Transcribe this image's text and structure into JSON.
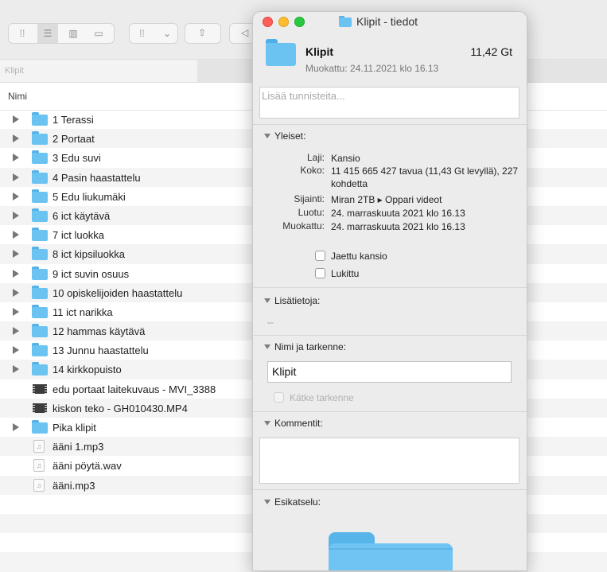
{
  "finder": {
    "path_current": "Klipit",
    "column_name": "Nimi",
    "rows": [
      {
        "label": "1 Terassi",
        "kind": "folder",
        "expandable": true
      },
      {
        "label": "2 Portaat",
        "kind": "folder",
        "expandable": true
      },
      {
        "label": "3 Edu suvi",
        "kind": "folder",
        "expandable": true
      },
      {
        "label": "4 Pasin haastattelu",
        "kind": "folder",
        "expandable": true
      },
      {
        "label": "5 Edu liukumäki",
        "kind": "folder",
        "expandable": true
      },
      {
        "label": "6 ict käytävä",
        "kind": "folder",
        "expandable": true
      },
      {
        "label": "7 ict luokka",
        "kind": "folder",
        "expandable": true
      },
      {
        "label": "8 ict kipsiluokka",
        "kind": "folder",
        "expandable": true
      },
      {
        "label": "9 ict suvin osuus",
        "kind": "folder",
        "expandable": true
      },
      {
        "label": "10 opiskelijoiden haastattelu",
        "kind": "folder",
        "expandable": true
      },
      {
        "label": "11 ict narikka",
        "kind": "folder",
        "expandable": true
      },
      {
        "label": "12 hammas käytävä",
        "kind": "folder",
        "expandable": true
      },
      {
        "label": "13 Junnu haastattelu",
        "kind": "folder",
        "expandable": true
      },
      {
        "label": "14 kirkkopuisto",
        "kind": "folder",
        "expandable": true
      },
      {
        "label": "edu portaat laitekuvaus - MVI_3388",
        "kind": "video",
        "expandable": false
      },
      {
        "label": "kiskon teko - GH010430.MP4",
        "kind": "video",
        "expandable": false
      },
      {
        "label": "Pika klipit",
        "kind": "folder",
        "expandable": true
      },
      {
        "label": "ääni 1.mp3",
        "kind": "audio",
        "expandable": false
      },
      {
        "label": "ääni pöytä.wav",
        "kind": "audio",
        "expandable": false
      },
      {
        "label": "ääni.mp3",
        "kind": "audio",
        "expandable": false
      }
    ],
    "empty_rows": 4
  },
  "info": {
    "window_title": "Klipit - tiedot",
    "name": "Klipit",
    "size": "11,42 Gt",
    "modified_header": "Muokattu: 24.11.2021 klo 16.13",
    "tags_placeholder": "Lisää tunnisteita...",
    "general": {
      "title": "Yleiset:",
      "laji_key": "Laji:",
      "laji_val": "Kansio",
      "koko_key": "Koko:",
      "koko_val": "11 415 665 427 tavua (11,43 Gt levyllä), 227 kohdetta",
      "sijainti_key": "Sijainti:",
      "sijainti_val": "Miran 2TB ▸ Oppari videot",
      "luotu_key": "Luotu:",
      "luotu_val": "24. marraskuuta 2021 klo 16.13",
      "muokattu_key": "Muokattu:",
      "muokattu_val": "24. marraskuuta 2021 klo 16.13",
      "shared_label": "Jaettu kansio",
      "locked_label": "Lukittu"
    },
    "more_info": {
      "title": "Lisätietoja:",
      "value": "--"
    },
    "name_ext": {
      "title": "Nimi ja tarkenne:",
      "value": "Klipit",
      "hide_ext_label": "Kätke tarkenne"
    },
    "comments": {
      "title": "Kommentit:"
    },
    "preview": {
      "title": "Esikatselu:"
    }
  },
  "colors": {
    "folder": "#6bc3f2",
    "close": "#fe5f57",
    "minimize": "#febc2e",
    "zoom": "#28c840"
  }
}
